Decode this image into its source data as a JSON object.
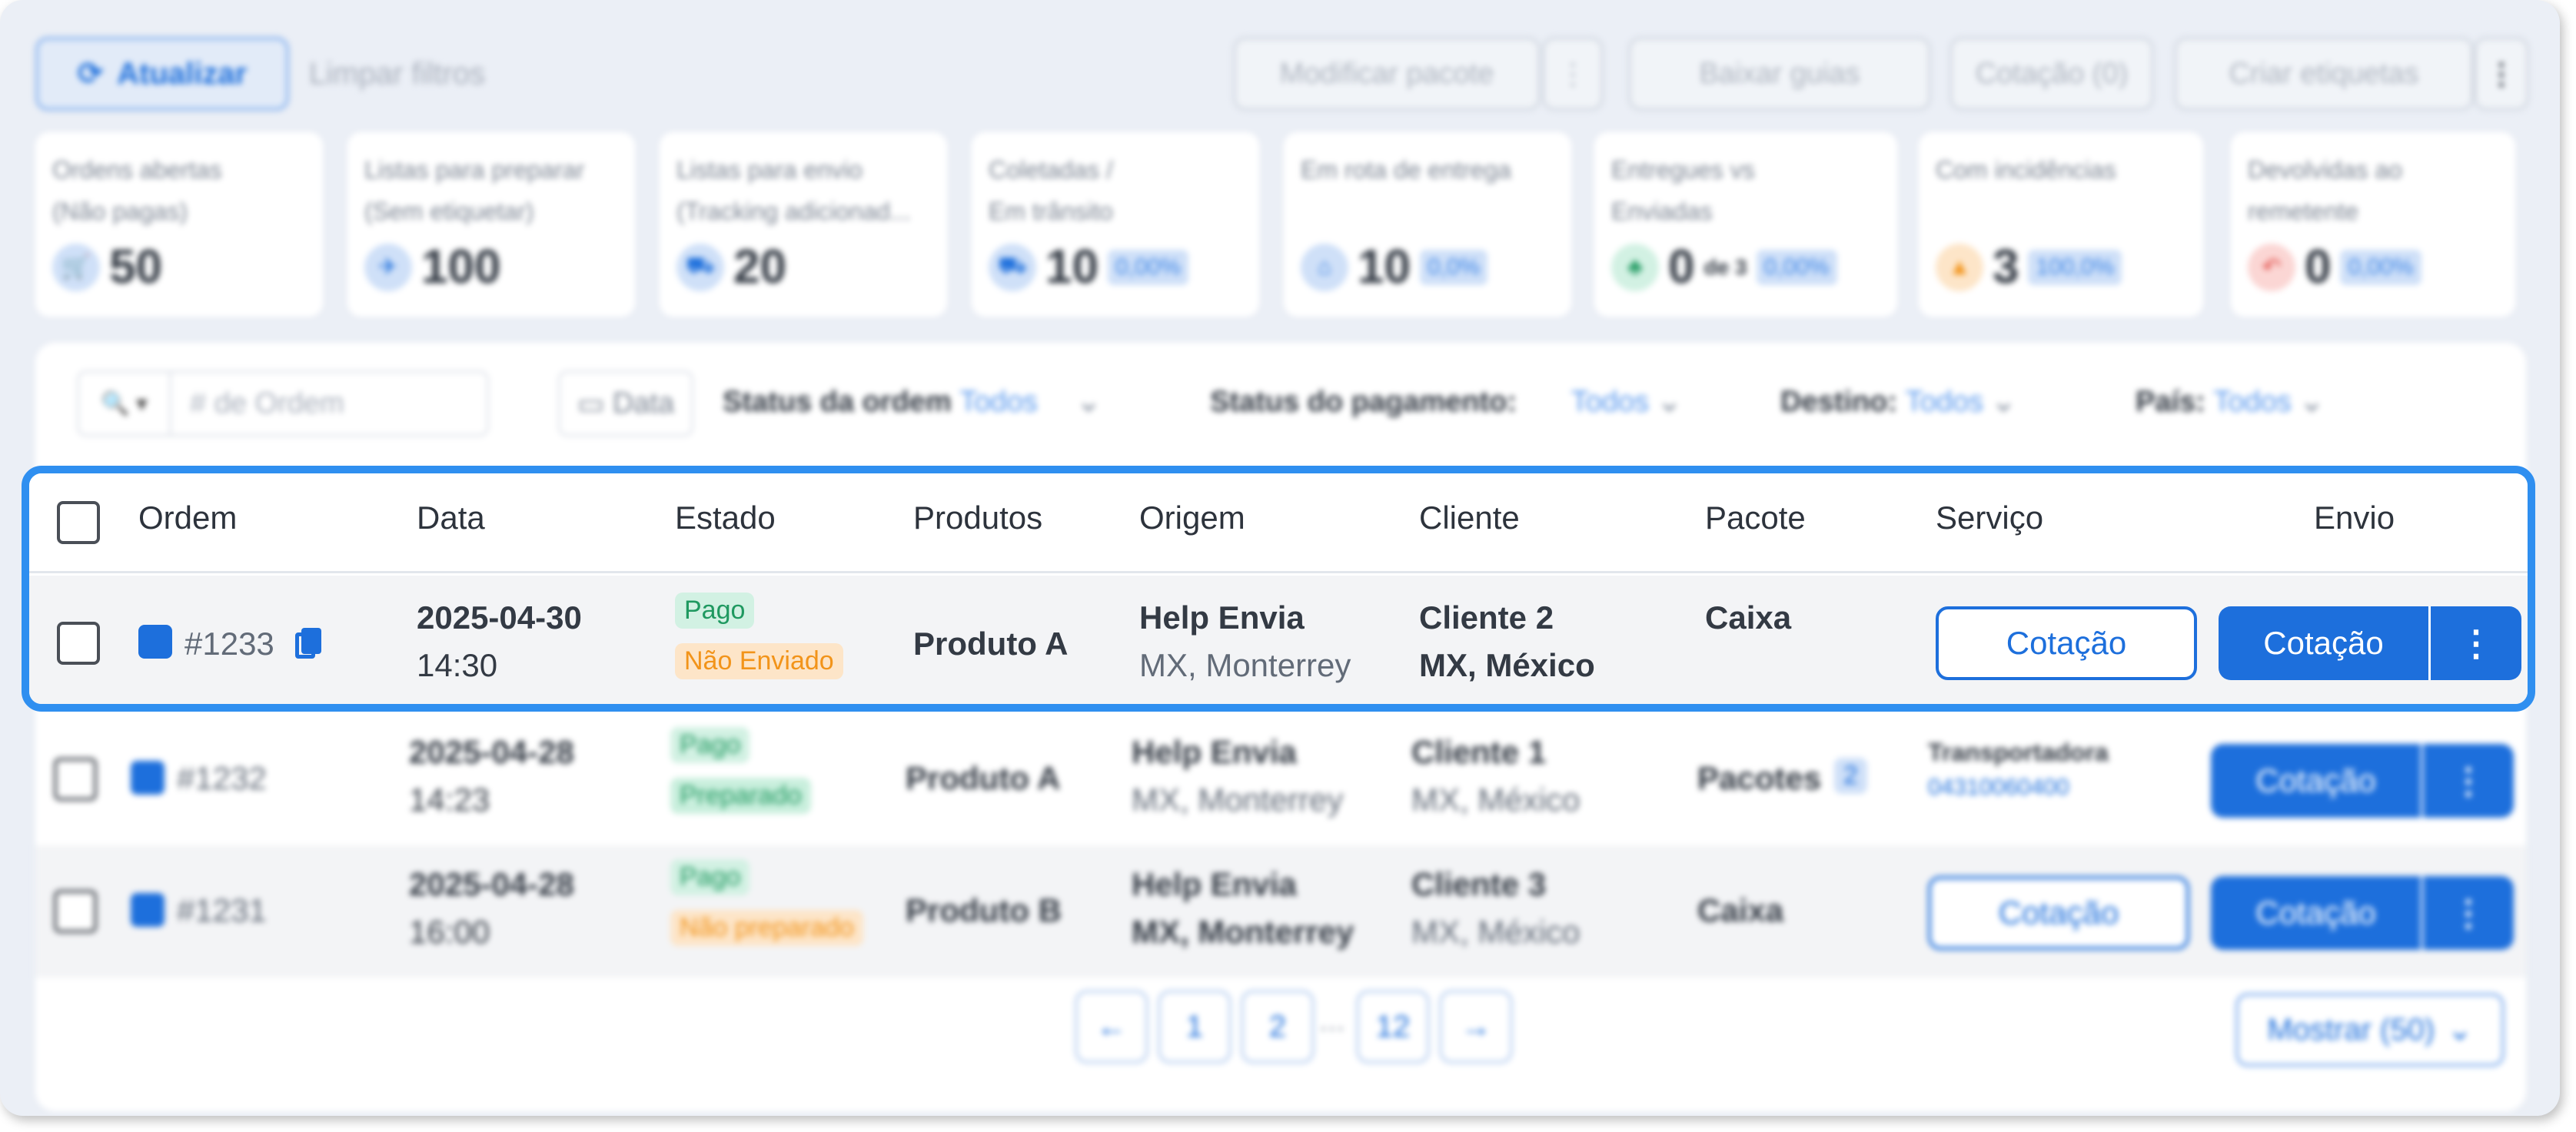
{
  "toolbar": {
    "refresh_label": "Atualizar",
    "clear_filters_label": "Limpar filtros",
    "modify_package_label": "Modificar pacote",
    "more_label": "⋮",
    "download_guides_label": "Baixar guias",
    "quote_count_label": "Cotação (0)",
    "create_labels_label": "Criar etiquetas"
  },
  "stats": [
    {
      "label": "Ordens abertas\n(Não pagas)",
      "value": "50",
      "icon": "cart-icon",
      "color": "#1d6fdc"
    },
    {
      "label": "Listas para preparar\n(Sem etiquetar)",
      "value": "100",
      "icon": "plane-icon",
      "color": "#1d6fdc"
    },
    {
      "label": "Listas para envio\n(Tracking adicionad...",
      "value": "20",
      "icon": "truck-icon",
      "color": "#1d6fdc"
    },
    {
      "label": "Coletadas /\nEm trânsito",
      "value": "10",
      "pct": "0,00%",
      "icon": "truck-icon",
      "color": "#1d6fdc"
    },
    {
      "label": "Em rota de entrega",
      "value": "10",
      "pct": "0,0%",
      "icon": "home-icon",
      "color": "#1d6fdc"
    },
    {
      "label": "Entregues vs\nEnviadas",
      "value": "0",
      "sub": "de 3",
      "pct": "0,00%",
      "icon": "people-icon",
      "color": "#1f9960"
    },
    {
      "label": "Com incidências",
      "value": "3",
      "pct": "100,0%",
      "icon": "warning-icon",
      "color": "#f2941a"
    },
    {
      "label": "Devolvidas ao\nremetente",
      "value": "0",
      "pct": "0,00%",
      "icon": "return-icon",
      "color": "#e0443e"
    }
  ],
  "filters": {
    "order_placeholder": "# de Ordem",
    "date_label": "Data",
    "order_status_label": "Status da ordem",
    "order_status_value": "Todos",
    "payment_status_label": "Status do pagamento:",
    "payment_status_value": "Todos",
    "destination_label": "Destino:",
    "destination_value": "Todos",
    "country_label": "País:",
    "country_value": "Todos"
  },
  "table": {
    "columns": [
      "Ordem",
      "Data",
      "Estado",
      "Produtos",
      "Origem",
      "Cliente",
      "Pacote",
      "Serviço",
      "Envio"
    ],
    "highlighted_row": {
      "order": "#1233",
      "date": "2025-04-30",
      "time": "14:30",
      "status_payment": "Pago",
      "status_shipping": "Não Enviado",
      "product": "Produto A",
      "origin_name": "Help Envia",
      "origin_location": "MX, Monterrey",
      "client_name": "Cliente 2",
      "client_location": "MX, México",
      "package": "Caixa",
      "service_button": "Cotação",
      "ship_button": "Cotação",
      "ship_more": "⋮"
    },
    "rows": [
      {
        "order": "#1232",
        "date": "2025-04-28",
        "time": "14:23",
        "status_payment": "Pago",
        "status_shipping": "Preparado",
        "product": "Produto A",
        "origin_name": "Help Envia",
        "origin_location": "MX, Monterrey",
        "client_name": "Cliente 1",
        "client_location": "MX, México",
        "package": "Pacotes",
        "package_count": "2",
        "carrier": "Transportadora",
        "tracking": "04310060400",
        "ship_button": "Cotação",
        "ship_more": "⋮"
      },
      {
        "order": "#1231",
        "date": "2025-04-28",
        "time": "16:00",
        "status_payment": "Pago",
        "status_shipping": "Não preparado",
        "product": "Produto B",
        "origin_name": "Help Envia",
        "origin_location": "MX, Monterrey",
        "client_name": "Cliente 3",
        "client_location": "MX, México",
        "package": "Caixa",
        "service_button": "Cotação",
        "ship_button": "Cotação",
        "ship_more": "⋮"
      }
    ]
  },
  "pagination": {
    "prev": "←",
    "page1": "1",
    "page2": "2",
    "dots": "...",
    "last": "12",
    "next": "→",
    "show_label": "Mostrar (50)"
  },
  "colors": {
    "accent": "#1d6fdc",
    "highlight_border": "#2f8ff0"
  }
}
